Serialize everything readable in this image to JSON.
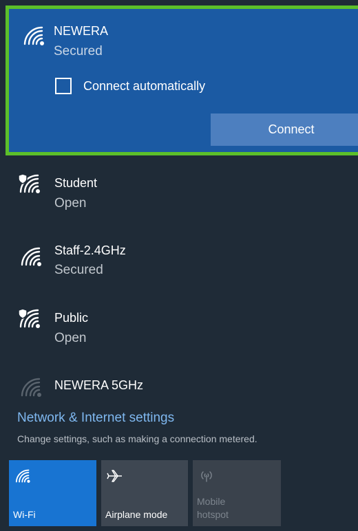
{
  "selected_network": {
    "name": "NEWERA",
    "status": "Secured",
    "checkbox_label": "Connect automatically",
    "connect_label": "Connect",
    "icon": "wifi-strong-icon"
  },
  "networks": [
    {
      "name": "Student",
      "status": "Open",
      "icon": "wifi-shield-icon"
    },
    {
      "name": "Staff-2.4GHz",
      "status": "Secured",
      "icon": "wifi-icon"
    },
    {
      "name": "Public",
      "status": "Open",
      "icon": "wifi-shield-icon"
    },
    {
      "name": "NEWERA 5GHz",
      "status": "",
      "icon": "wifi-weak-icon"
    }
  ],
  "settings": {
    "link": "Network & Internet settings",
    "description": "Change settings, such as making a connection metered."
  },
  "quick_actions": [
    {
      "label": "Wi-Fi",
      "icon": "wifi-icon",
      "state": "on"
    },
    {
      "label": "Airplane mode",
      "icon": "airplane-icon",
      "state": "off"
    },
    {
      "label": "Mobile\nhotspot",
      "icon": "hotspot-icon",
      "state": "disabled"
    }
  ],
  "colors": {
    "background": "#1f2b37",
    "selected_card": "#1b5aa3",
    "highlight_border": "#5cbf2a",
    "connect_button": "#4d7fbf",
    "link": "#7fb8f0",
    "wifi_tile_on": "#1874d2"
  }
}
